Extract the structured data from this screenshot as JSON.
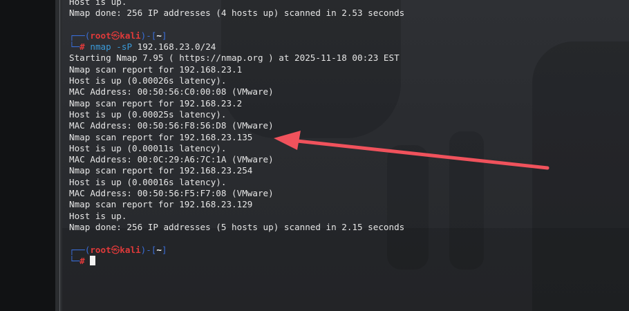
{
  "prompt": {
    "open_bracket": "┌──(",
    "user": "root",
    "skull": "㉿",
    "host": "kali",
    "mid": ")-[",
    "dir": "~",
    "close": "]",
    "prefix2": "└─",
    "hash": "#"
  },
  "terminal": {
    "lines_top": [
      "Host is up.",
      "Nmap done: 256 IP addresses (4 hosts up) scanned in 2.53 seconds"
    ],
    "command": {
      "name": "nmap",
      "flag": "-sP",
      "arg": "192.168.23.0/24"
    },
    "output": [
      "Starting Nmap 7.95 ( https://nmap.org ) at 2025-11-18 00:23 EST",
      "Nmap scan report for 192.168.23.1",
      "Host is up (0.00026s latency).",
      "MAC Address: 00:50:56:C0:00:08 (VMware)",
      "Nmap scan report for 192.168.23.2",
      "Host is up (0.00025s latency).",
      "MAC Address: 00:50:56:F8:56:D8 (VMware)",
      "Nmap scan report for 192.168.23.135",
      "Host is up (0.00011s latency).",
      "MAC Address: 00:0C:29:A6:7C:1A (VMware)",
      "Nmap scan report for 192.168.23.254",
      "Host is up (0.00016s latency).",
      "MAC Address: 00:50:56:F5:F7:08 (VMware)",
      "Nmap scan report for 192.168.23.129",
      "Host is up.",
      "Nmap done: 256 IP addresses (5 hosts up) scanned in 2.15 seconds"
    ]
  },
  "colors": {
    "background": "#2b2d30",
    "prompt_blue": "#3a6ed8",
    "prompt_red": "#e03a3a",
    "text": "#e6e6e6",
    "annotation_arrow": "#f0525c"
  },
  "annotation": {
    "arrow_icon": "red-arrow-icon"
  }
}
